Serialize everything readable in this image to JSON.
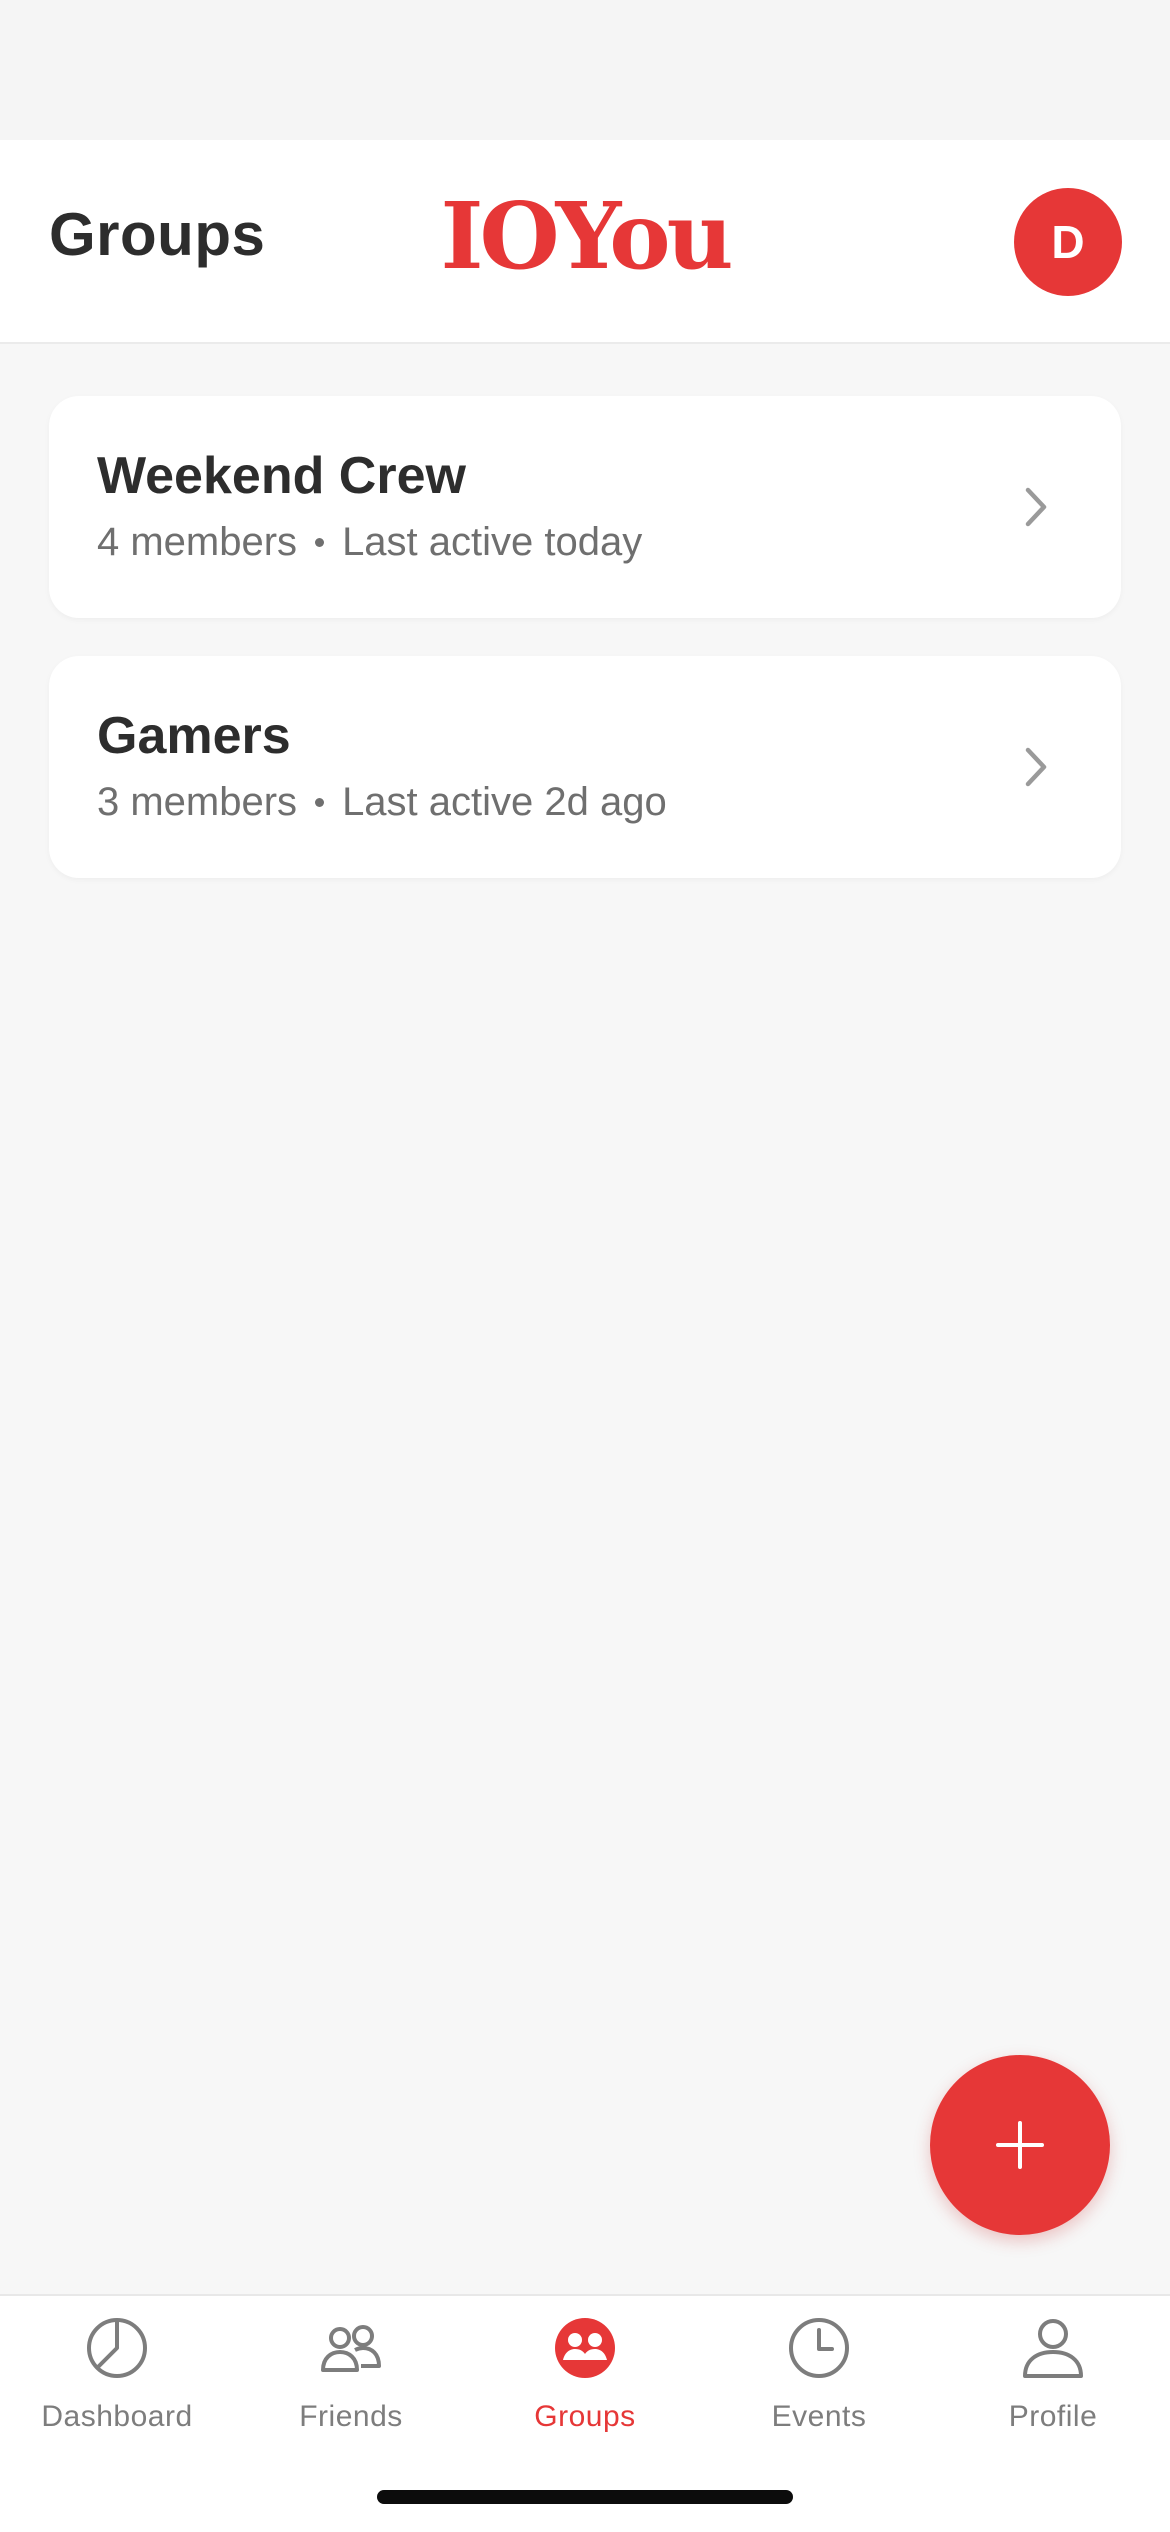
{
  "header": {
    "title": "Groups",
    "brand": "IOYou",
    "avatar_initial": "D"
  },
  "groups": [
    {
      "name": "Weekend Crew",
      "members": "4 members",
      "activity": "Last active today"
    },
    {
      "name": "Gamers",
      "members": "3 members",
      "activity": "Last active 2d ago"
    }
  ],
  "tabs": [
    {
      "label": "Dashboard",
      "icon": "pie-chart-icon",
      "active": false
    },
    {
      "label": "Friends",
      "icon": "friends-icon",
      "active": false
    },
    {
      "label": "Groups",
      "icon": "groups-icon",
      "active": true
    },
    {
      "label": "Events",
      "icon": "clock-icon",
      "active": false
    },
    {
      "label": "Profile",
      "icon": "person-icon",
      "active": false
    }
  ],
  "fab": {
    "icon": "plus-icon"
  },
  "colors": {
    "accent": "#e63737",
    "background": "#f7f7f7",
    "inactive": "#7d7d7d"
  }
}
